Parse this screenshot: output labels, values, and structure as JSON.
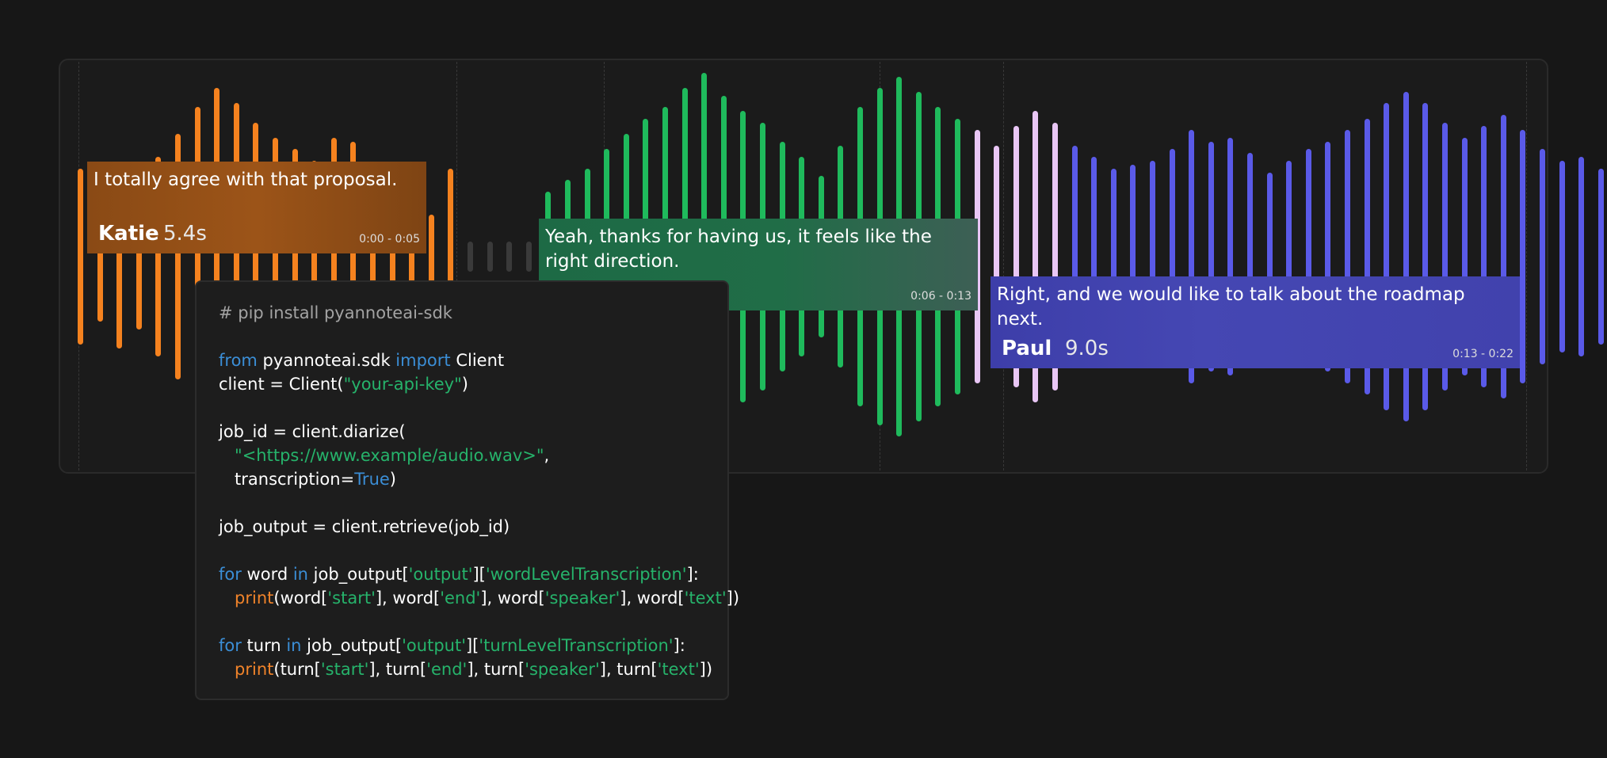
{
  "colors": {
    "background": "#171717",
    "katie": "#f5821f",
    "middle": "#1fba5c",
    "highlight": "#e9c6f5",
    "paul": "#5a5ae8",
    "neutral": "#3a3a3a",
    "code_comment": "#a3a3a3",
    "code_keyword": "#3b8ed6",
    "code_string": "#26b36b",
    "code_function": "#f0832a"
  },
  "segments": [
    {
      "id": "katie",
      "text": "I totally agree with that proposal.",
      "speaker": "Katie",
      "duration": "5.4s",
      "time_range": "0:00 - 0:05"
    },
    {
      "id": "yeah",
      "text": "Yeah, thanks for having us, it feels like the right direction.",
      "speaker": "",
      "duration": "",
      "time_range": "0:06 - 0:13"
    },
    {
      "id": "paul",
      "text": "Right, and we would like to talk about the roadmap next.",
      "speaker": "Paul",
      "duration": "9.0s",
      "time_range": "0:13 - 0:22"
    }
  ],
  "waveform_bars": [
    {
      "c": "katie",
      "h": 0.46
    },
    {
      "c": "katie",
      "h": 0.34
    },
    {
      "c": "katie",
      "h": 0.48
    },
    {
      "c": "katie",
      "h": 0.38
    },
    {
      "c": "katie",
      "h": 0.52
    },
    {
      "c": "katie",
      "h": 0.64
    },
    {
      "c": "katie",
      "h": 0.78
    },
    {
      "c": "katie",
      "h": 0.88
    },
    {
      "c": "katie",
      "h": 0.8
    },
    {
      "c": "katie",
      "h": 0.7
    },
    {
      "c": "katie",
      "h": 0.62
    },
    {
      "c": "katie",
      "h": 0.56
    },
    {
      "c": "katie",
      "h": 0.5
    },
    {
      "c": "katie",
      "h": 0.62
    },
    {
      "c": "katie",
      "h": 0.6
    },
    {
      "c": "katie",
      "h": 0.46
    },
    {
      "c": "katie",
      "h": 0.38
    },
    {
      "c": "katie",
      "h": 0.3
    },
    {
      "c": "katie",
      "h": 0.22
    },
    {
      "c": "katie",
      "h": 0.46
    },
    {
      "c": "neutral",
      "h": 0.08
    },
    {
      "c": "neutral",
      "h": 0.08
    },
    {
      "c": "neutral",
      "h": 0.08
    },
    {
      "c": "neutral",
      "h": 0.08
    },
    {
      "c": "middle",
      "h": 0.34
    },
    {
      "c": "middle",
      "h": 0.4
    },
    {
      "c": "middle",
      "h": 0.46
    },
    {
      "c": "middle",
      "h": 0.56
    },
    {
      "c": "middle",
      "h": 0.64
    },
    {
      "c": "middle",
      "h": 0.72
    },
    {
      "c": "middle",
      "h": 0.78
    },
    {
      "c": "middle",
      "h": 0.88
    },
    {
      "c": "middle",
      "h": 0.96
    },
    {
      "c": "middle",
      "h": 0.84
    },
    {
      "c": "middle",
      "h": 0.76
    },
    {
      "c": "middle",
      "h": 0.7
    },
    {
      "c": "middle",
      "h": 0.6
    },
    {
      "c": "middle",
      "h": 0.52
    },
    {
      "c": "middle",
      "h": 0.42
    },
    {
      "c": "middle",
      "h": 0.58
    },
    {
      "c": "middle",
      "h": 0.78
    },
    {
      "c": "middle",
      "h": 0.88
    },
    {
      "c": "middle",
      "h": 0.94
    },
    {
      "c": "middle",
      "h": 0.86
    },
    {
      "c": "middle",
      "h": 0.78
    },
    {
      "c": "middle",
      "h": 0.72
    },
    {
      "c": "highlight",
      "h": 0.66
    },
    {
      "c": "highlight",
      "h": 0.58
    },
    {
      "c": "highlight",
      "h": 0.68
    },
    {
      "c": "highlight",
      "h": 0.76
    },
    {
      "c": "highlight",
      "h": 0.7
    },
    {
      "c": "paul",
      "h": 0.58
    },
    {
      "c": "paul",
      "h": 0.52
    },
    {
      "c": "paul",
      "h": 0.46
    },
    {
      "c": "paul",
      "h": 0.48
    },
    {
      "c": "paul",
      "h": 0.5
    },
    {
      "c": "paul",
      "h": 0.56
    },
    {
      "c": "paul",
      "h": 0.66
    },
    {
      "c": "paul",
      "h": 0.6
    },
    {
      "c": "paul",
      "h": 0.62
    },
    {
      "c": "paul",
      "h": 0.54
    },
    {
      "c": "paul",
      "h": 0.44
    },
    {
      "c": "paul",
      "h": 0.5
    },
    {
      "c": "paul",
      "h": 0.56
    },
    {
      "c": "paul",
      "h": 0.6
    },
    {
      "c": "paul",
      "h": 0.66
    },
    {
      "c": "paul",
      "h": 0.72
    },
    {
      "c": "paul",
      "h": 0.8
    },
    {
      "c": "paul",
      "h": 0.86
    },
    {
      "c": "paul",
      "h": 0.8
    },
    {
      "c": "paul",
      "h": 0.7
    },
    {
      "c": "paul",
      "h": 0.62
    },
    {
      "c": "paul",
      "h": 0.68
    },
    {
      "c": "paul",
      "h": 0.74
    },
    {
      "c": "paul",
      "h": 0.66
    },
    {
      "c": "paul",
      "h": 0.56
    },
    {
      "c": "paul",
      "h": 0.5
    },
    {
      "c": "paul",
      "h": 0.52
    },
    {
      "c": "paul",
      "h": 0.46
    }
  ],
  "code": {
    "lines": [
      [
        {
          "t": "# pip install pyannoteai-sdk",
          "s": "com"
        }
      ],
      [],
      [
        {
          "t": "from",
          "s": "kw"
        },
        {
          "t": " pyannoteai.sdk ",
          "s": "plain"
        },
        {
          "t": "import",
          "s": "kw"
        },
        {
          "t": " Client",
          "s": "plain"
        }
      ],
      [
        {
          "t": "client = Client(",
          "s": "plain"
        },
        {
          "t": "\"your-api-key\"",
          "s": "str"
        },
        {
          "t": ")",
          "s": "plain"
        }
      ],
      [],
      [
        {
          "t": "job_id = client.diarize(",
          "s": "plain"
        }
      ],
      [
        {
          "t": "   ",
          "s": "plain"
        },
        {
          "t": "\"<https://www.example/audio.wav>\"",
          "s": "str"
        },
        {
          "t": ",",
          "s": "plain"
        }
      ],
      [
        {
          "t": "   transcription=",
          "s": "plain"
        },
        {
          "t": "True",
          "s": "kw"
        },
        {
          "t": ")",
          "s": "plain"
        }
      ],
      [],
      [
        {
          "t": "job_output = client.retrieve(job_id)",
          "s": "plain"
        }
      ],
      [],
      [
        {
          "t": "for",
          "s": "kw"
        },
        {
          "t": " word ",
          "s": "plain"
        },
        {
          "t": "in",
          "s": "kw"
        },
        {
          "t": " job_output[",
          "s": "plain"
        },
        {
          "t": "'output'",
          "s": "str"
        },
        {
          "t": "][",
          "s": "plain"
        },
        {
          "t": "'wordLevelTranscription'",
          "s": "str"
        },
        {
          "t": "]:",
          "s": "plain"
        }
      ],
      [
        {
          "t": "   ",
          "s": "plain"
        },
        {
          "t": "print",
          "s": "fn"
        },
        {
          "t": "(word[",
          "s": "plain"
        },
        {
          "t": "'start'",
          "s": "str"
        },
        {
          "t": "], word[",
          "s": "plain"
        },
        {
          "t": "'end'",
          "s": "str"
        },
        {
          "t": "], word[",
          "s": "plain"
        },
        {
          "t": "'speaker'",
          "s": "str"
        },
        {
          "t": "], word[",
          "s": "plain"
        },
        {
          "t": "'text'",
          "s": "str"
        },
        {
          "t": "])",
          "s": "plain"
        }
      ],
      [],
      [
        {
          "t": "for",
          "s": "kw"
        },
        {
          "t": " turn ",
          "s": "plain"
        },
        {
          "t": "in",
          "s": "kw"
        },
        {
          "t": " job_output[",
          "s": "plain"
        },
        {
          "t": "'output'",
          "s": "str"
        },
        {
          "t": "][",
          "s": "plain"
        },
        {
          "t": "'turnLevelTranscription'",
          "s": "str"
        },
        {
          "t": "]:",
          "s": "plain"
        }
      ],
      [
        {
          "t": "   ",
          "s": "plain"
        },
        {
          "t": "print",
          "s": "fn"
        },
        {
          "t": "(turn[",
          "s": "plain"
        },
        {
          "t": "'start'",
          "s": "str"
        },
        {
          "t": "], turn[",
          "s": "plain"
        },
        {
          "t": "'end'",
          "s": "str"
        },
        {
          "t": "], turn[",
          "s": "plain"
        },
        {
          "t": "'speaker'",
          "s": "str"
        },
        {
          "t": "], turn[",
          "s": "plain"
        },
        {
          "t": "'text'",
          "s": "str"
        },
        {
          "t": "])",
          "s": "plain"
        }
      ]
    ]
  }
}
